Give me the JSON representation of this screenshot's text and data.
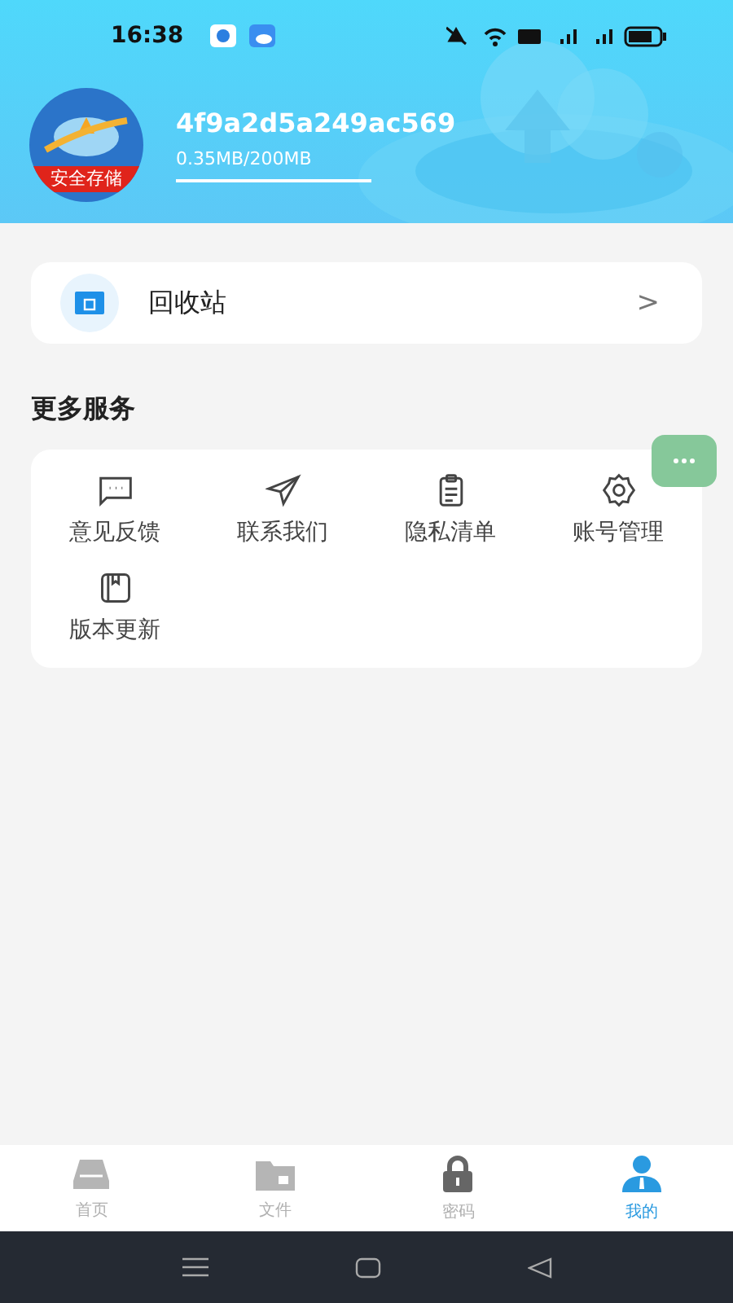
{
  "status_bar": {
    "time": "16:38"
  },
  "profile": {
    "avatar_badge": "安全存储",
    "user_id": "4f9a2d5a249ac569",
    "storage": "0.35MB/200MB"
  },
  "recycle": {
    "label": "回收站",
    "chevron": ">"
  },
  "services": {
    "title": "更多服务",
    "items": [
      {
        "kind": "feedback",
        "label": "意见反馈"
      },
      {
        "kind": "contact",
        "label": "联系我们"
      },
      {
        "kind": "privacy",
        "label": "隐私清单"
      },
      {
        "kind": "account",
        "label": "账号管理"
      },
      {
        "kind": "update",
        "label": "版本更新"
      }
    ]
  },
  "tabs": [
    {
      "kind": "home",
      "label": "首页",
      "selected": false
    },
    {
      "kind": "files",
      "label": "文件",
      "selected": false
    },
    {
      "kind": "password",
      "label": "密码",
      "selected": false
    },
    {
      "kind": "me",
      "label": "我的",
      "selected": true
    }
  ]
}
